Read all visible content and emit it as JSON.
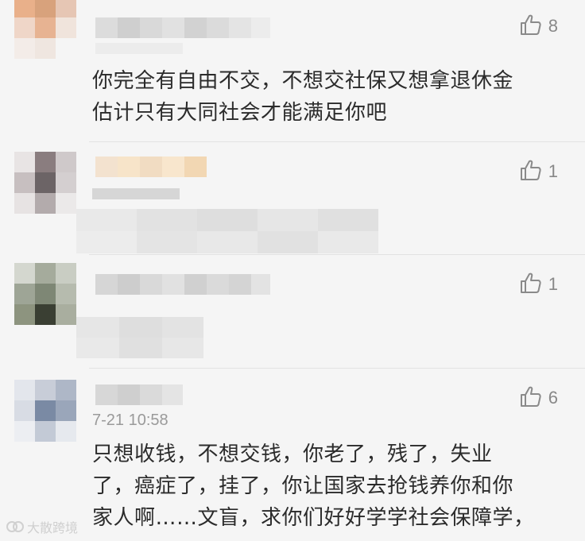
{
  "comments": [
    {
      "likes": "8",
      "text_line1": "你完全有自由不交，不想交社保又想拿退休金",
      "text_line2": "估计只有大同社会才能满足你吧"
    },
    {
      "likes": "1"
    },
    {
      "likes": "1"
    },
    {
      "likes": "6",
      "time": "7-21 10:58",
      "text_line1": "只想收钱，不想交钱，你老了，残了，失业",
      "text_line2": "了，癌症了，挂了，你让国家去抢钱养你和你",
      "text_line3": "家人啊……文盲，求你们好好学学社会保障学，"
    }
  ],
  "watermark": {
    "text": "大散跨境"
  },
  "colors": {
    "like_icon": "#8a8a8a",
    "background": "#f5f5f5",
    "divider": "#e2e2e2"
  },
  "icons": {
    "like": "thumbs-up-icon"
  }
}
